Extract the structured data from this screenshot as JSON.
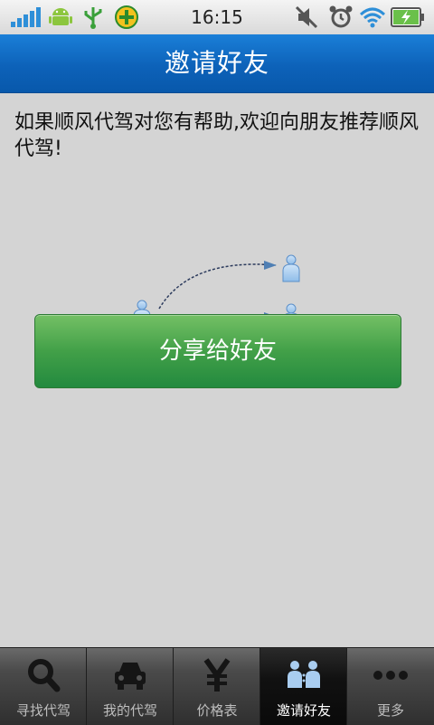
{
  "status_bar": {
    "time": "16:15",
    "left_icons": [
      "signal-bars-icon",
      "android-icon",
      "usb-icon",
      "security-app-icon"
    ],
    "right_icons": [
      "mute-icon",
      "alarm-icon",
      "wifi-icon",
      "battery-charging-icon"
    ]
  },
  "header": {
    "title": "邀请好友"
  },
  "main": {
    "intro_text": "如果顺风代驾对您有帮助,欢迎向朋友推荐顺风代驾!",
    "diagram_icons": [
      "person-icon",
      "person-icon",
      "person-icon",
      "person-icon"
    ],
    "share_button_label": "分享给好友"
  },
  "tabbar": {
    "tabs": [
      {
        "label": "寻找代驾",
        "icon": "search-icon",
        "active": false
      },
      {
        "label": "我的代驾",
        "icon": "car-icon",
        "active": false
      },
      {
        "label": "价格表",
        "icon": "yen-icon",
        "active": false
      },
      {
        "label": "邀请好友",
        "icon": "invite-friends-icon",
        "active": true
      },
      {
        "label": "更多",
        "icon": "more-icon",
        "active": false
      }
    ]
  },
  "colors": {
    "header_blue": "#0d62b9",
    "button_green": "#42a048",
    "background": "#d4d4d4",
    "tabbar_dark": "#2f2f2f",
    "person_icon_blue": "#9fc6ec"
  }
}
